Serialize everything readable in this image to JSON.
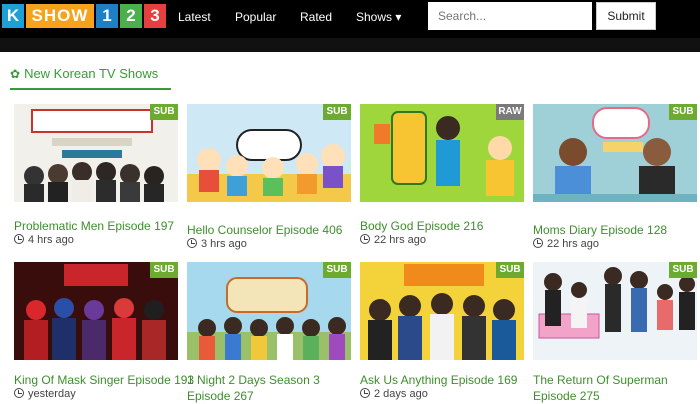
{
  "logo": {
    "k": "K",
    "show": "SHOW",
    "n1": "1",
    "n2": "2",
    "n3": "3"
  },
  "nav": {
    "latest": "Latest",
    "popular": "Popular",
    "rated": "Rated",
    "shows": "Shows ▾"
  },
  "search": {
    "placeholder": "Search...",
    "submit": "Submit"
  },
  "section": {
    "title": "New Korean TV Shows"
  },
  "colors": {
    "accent": "#3a9a3a",
    "sub_badge": "#6cab2f",
    "raw_badge": "#7a7a7a"
  },
  "shows": [
    {
      "title": "Problematic Men Episode 197",
      "time": "4 hrs ago",
      "badge": "SUB"
    },
    {
      "title": "Hello Counselor Episode 406",
      "time": "3 hrs ago",
      "badge": "SUB"
    },
    {
      "title": "Body God Episode 216",
      "time": "22 hrs ago",
      "badge": "RAW"
    },
    {
      "title": "Moms Diary Episode 128",
      "time": "22 hrs ago",
      "badge": "SUB"
    },
    {
      "title": "King Of Mask Singer Episode 193",
      "time": "yesterday",
      "badge": "SUB"
    },
    {
      "title": "1 Night 2 Days Season 3 Episode 267",
      "time": "",
      "badge": "SUB"
    },
    {
      "title": "Ask Us Anything Episode 169",
      "time": "2 days ago",
      "badge": "SUB"
    },
    {
      "title": "The Return Of Superman Episode 275",
      "time": "",
      "badge": "SUB"
    }
  ]
}
